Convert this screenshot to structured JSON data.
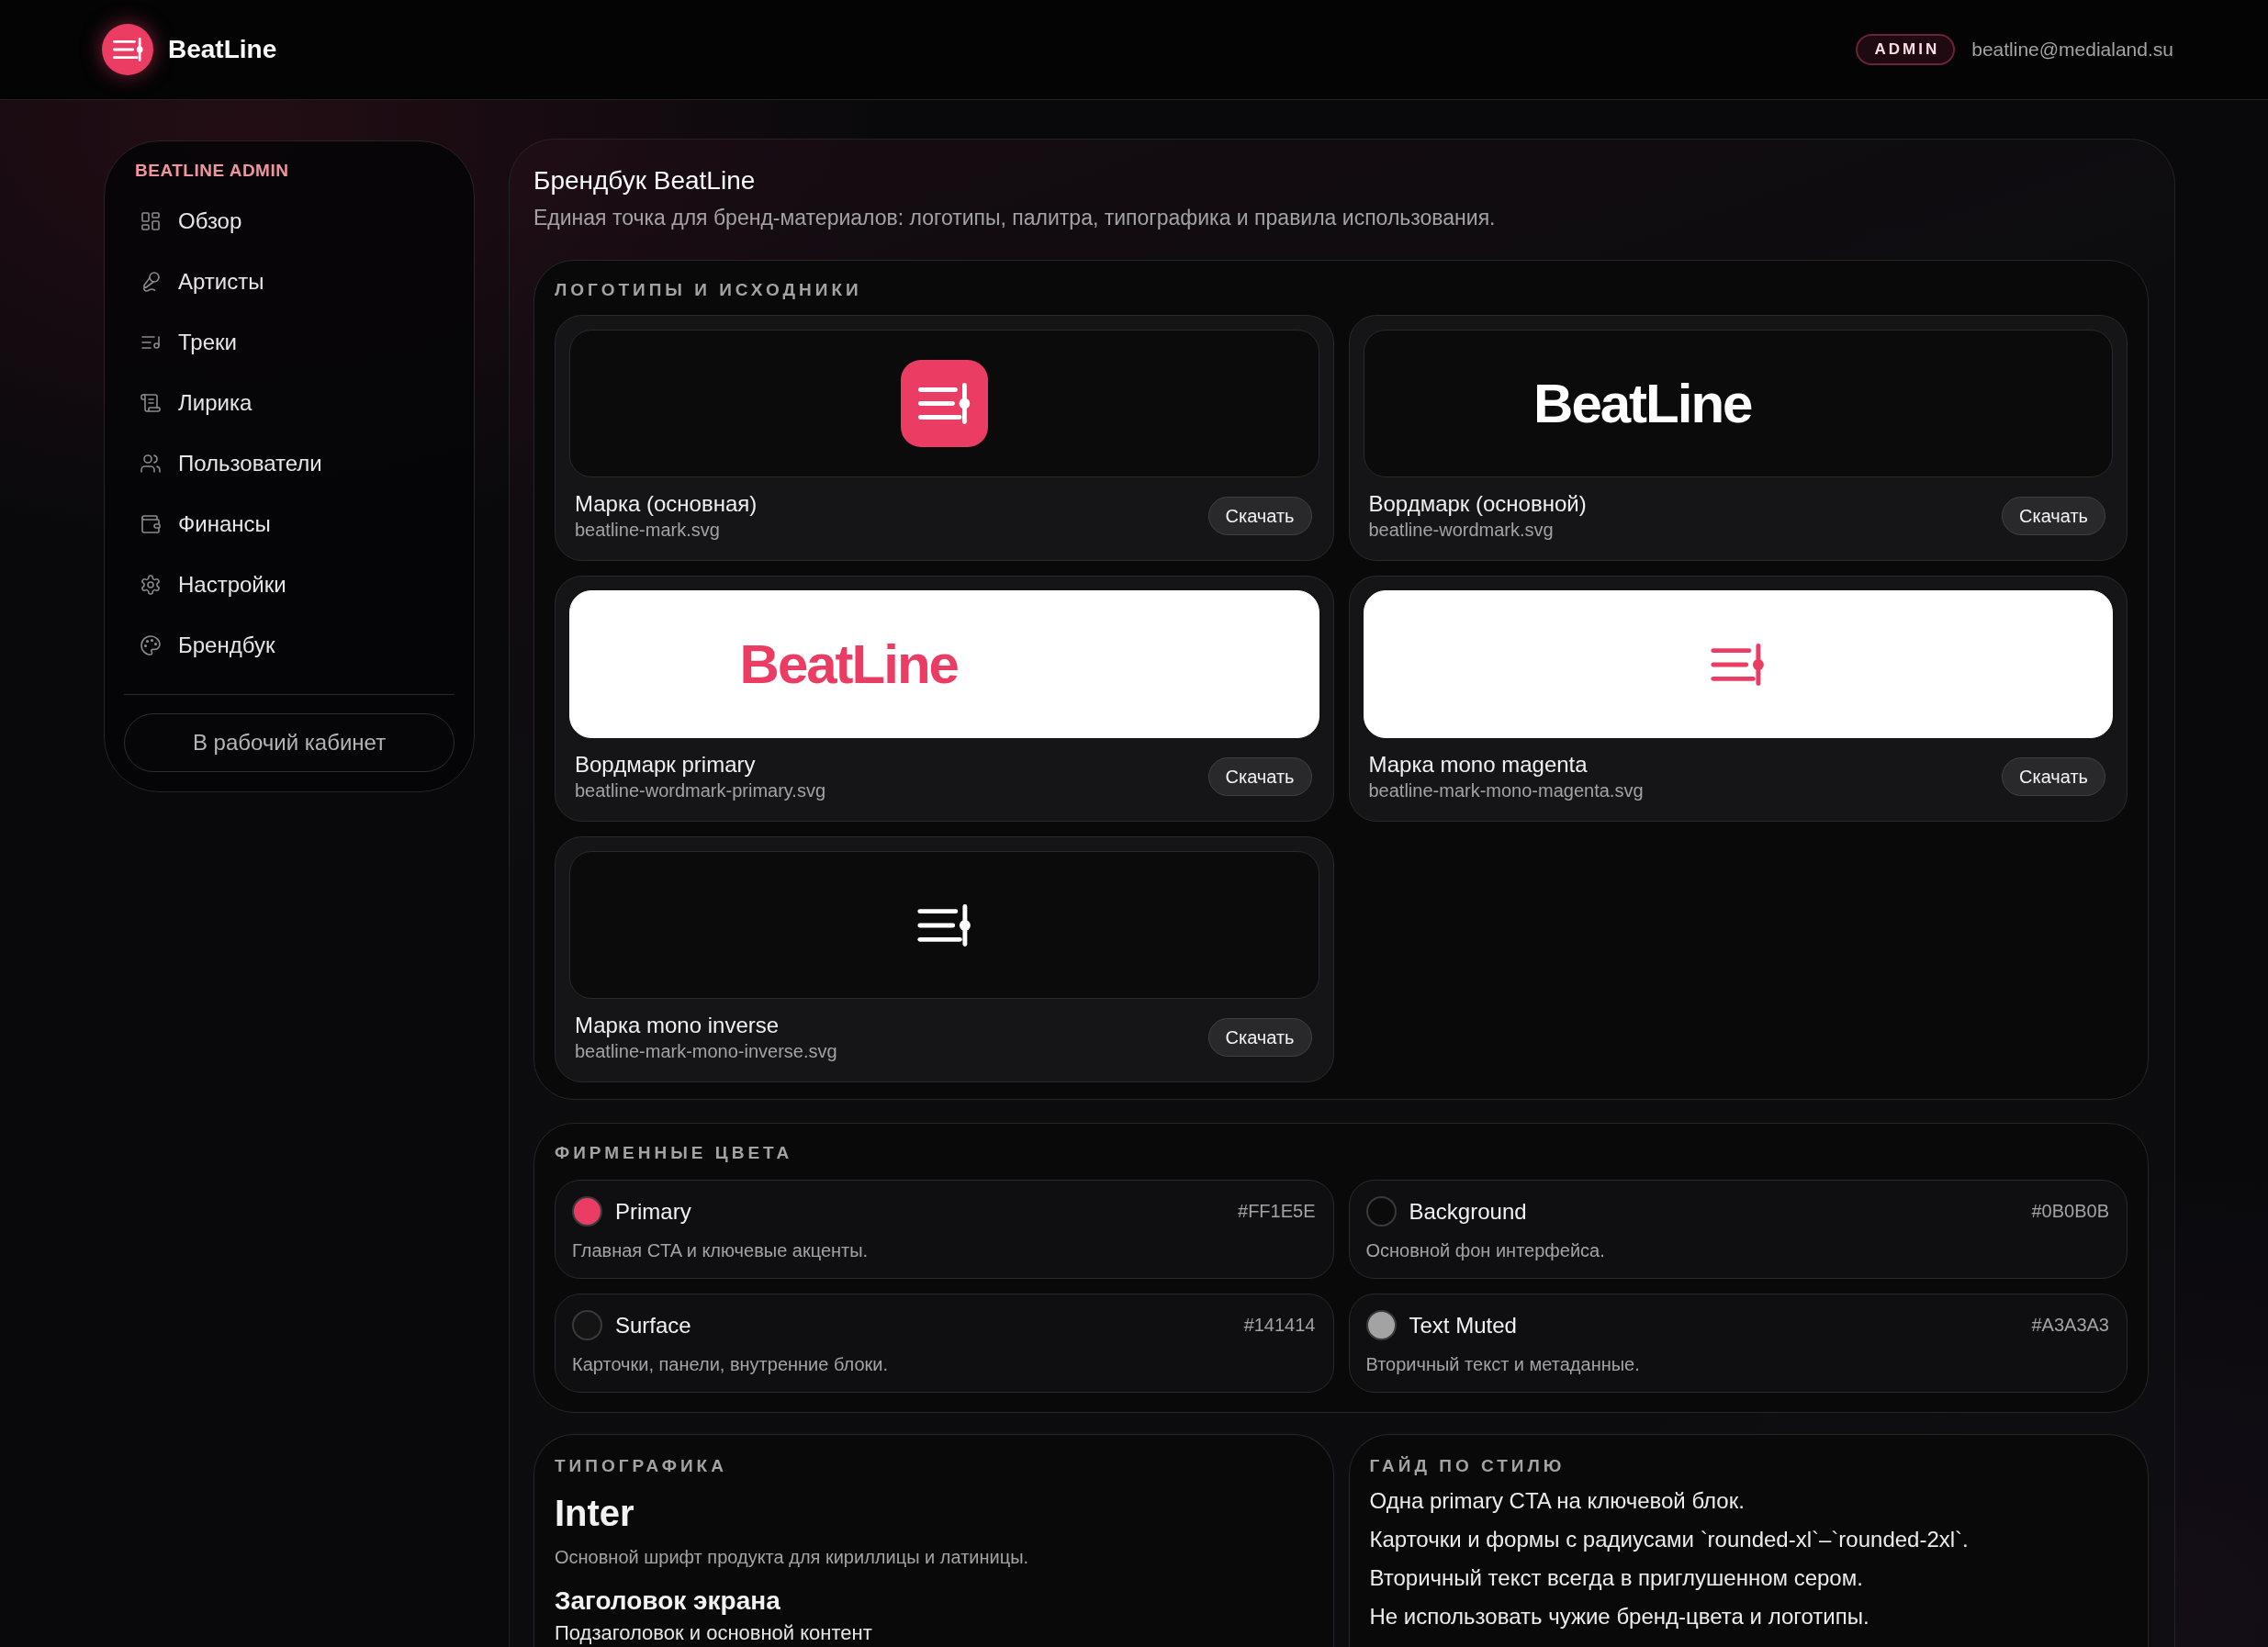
{
  "header": {
    "brand": "BeatLine",
    "badge": "ADMIN",
    "email": "beatline@medialand.su"
  },
  "sidebar": {
    "title": "BEATLINE ADMIN",
    "items": [
      {
        "label": "Обзор",
        "selected": false
      },
      {
        "label": "Артисты",
        "selected": false
      },
      {
        "label": "Треки",
        "selected": false
      },
      {
        "label": "Лирика",
        "selected": false
      },
      {
        "label": "Пользователи",
        "selected": false
      },
      {
        "label": "Финансы",
        "selected": false
      },
      {
        "label": "Настройки",
        "selected": false
      },
      {
        "label": "Брендбук",
        "selected": false
      }
    ],
    "button": "В рабочий кабинет"
  },
  "page": {
    "title": "Брендбук BeatLine",
    "subtitle": "Единая точка для бренд-материалов: логотипы, палитра, типографика и правила использования."
  },
  "logos": {
    "heading": "ЛОГОТИПЫ И ИСХОДНИКИ",
    "items": [
      {
        "kind": "mark-tile",
        "light_background": false,
        "brand_ink": true,
        "name": "Марка (основная)",
        "file": "beatline-mark.svg",
        "button": "Скачать"
      },
      {
        "kind": "wordmark",
        "light_background": false,
        "brand_ink": false,
        "wordmark": "BeatLine",
        "name": "Вордмарк (основной)",
        "file": "beatline-wordmark.svg",
        "button": "Скачать"
      },
      {
        "kind": "wordmark",
        "light_background": true,
        "brand_ink": true,
        "wordmark": "BeatLine",
        "name": "Вордмарк primary",
        "file": "beatline-wordmark-primary.svg",
        "button": "Скачать"
      },
      {
        "kind": "mark",
        "light_background": true,
        "brand_ink": true,
        "name": "Марка mono magenta",
        "file": "beatline-mark-mono-magenta.svg",
        "button": "Скачать"
      },
      {
        "kind": "mark",
        "light_background": false,
        "brand_ink": false,
        "name": "Марка mono inverse",
        "file": "beatline-mark-mono-inverse.svg",
        "button": "Скачать"
      }
    ]
  },
  "colors": {
    "heading": "ФИРМЕННЫЕ ЦВЕТА",
    "items": [
      {
        "name": "Primary",
        "hex": "#FF1E5E",
        "description": "Главная CTA и ключевые акценты.",
        "color": "#eb3d63"
      },
      {
        "name": "Background",
        "hex": "#0B0B0B",
        "description": "Основной фон интерфейса.",
        "color": "#0b0b0b"
      },
      {
        "name": "Surface",
        "hex": "#141414",
        "description": "Карточки, панели, внутренние блоки.",
        "color": "#141414"
      },
      {
        "name": "Text Muted",
        "hex": "#A3A3A3",
        "description": "Вторичный текст и метаданные.",
        "color": "#a3a3a3"
      }
    ]
  },
  "typography": {
    "heading": "ТИПОГРАФИКА",
    "font": "Inter",
    "note": "Основной шрифт продукта для кириллицы и латиницы.",
    "samples": [
      {
        "kind": "heading",
        "text": "Заголовок экрана"
      },
      {
        "kind": "body",
        "text": "Подзаголовок и основной контент"
      }
    ]
  },
  "style_guide": {
    "heading": "ГАЙД ПО СТИЛЮ",
    "rules": [
      "Одна primary CTA на ключевой блок.",
      "Карточки и формы с радиусами `rounded-xl`–`rounded-2xl`.",
      "Вторичный текст всегда в приглушенном сером.",
      "Не использовать чужие бренд-цвета и логотипы."
    ]
  }
}
